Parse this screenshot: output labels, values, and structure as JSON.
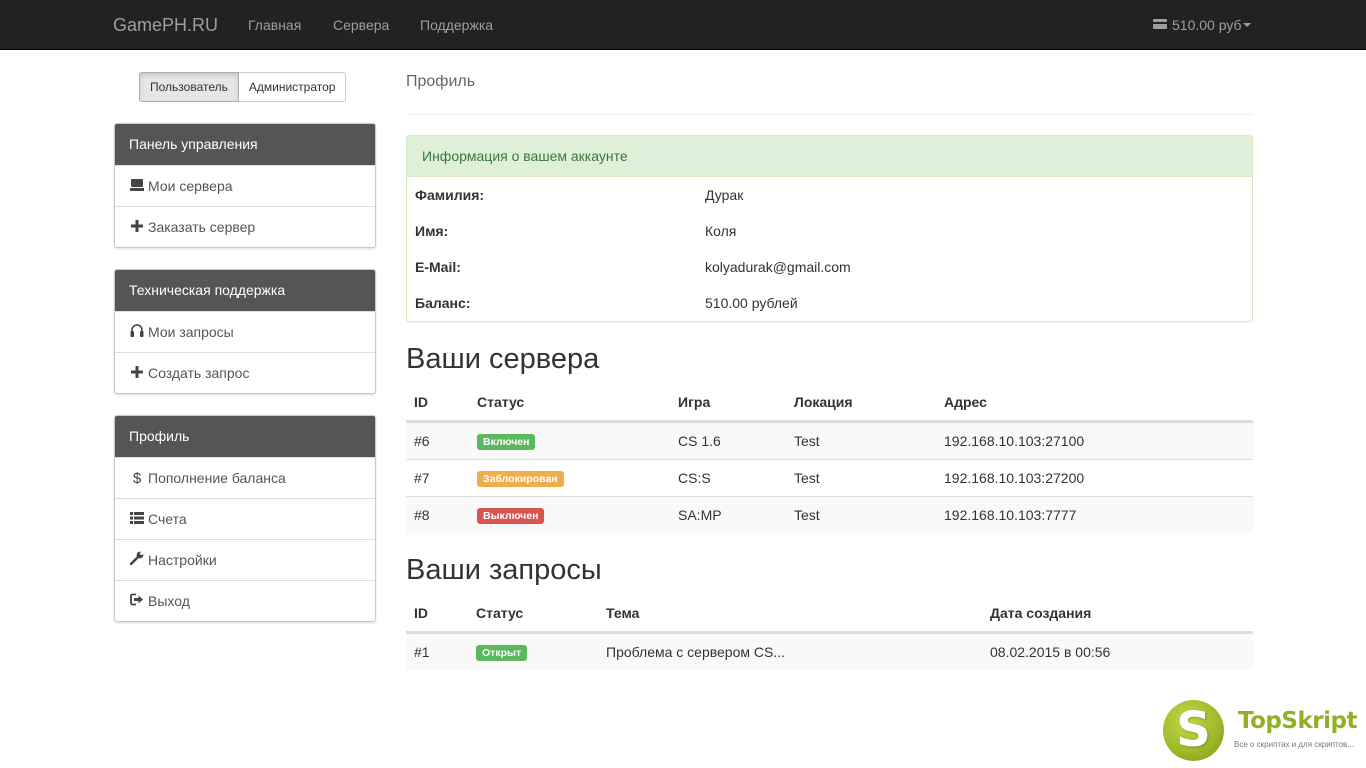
{
  "navbar": {
    "brand": "GamePH.RU",
    "links": [
      "Главная",
      "Сервера",
      "Поддержка"
    ],
    "balance": "510.00 руб"
  },
  "role_switch": {
    "user": "Пользователь",
    "admin": "Администратор"
  },
  "sidebar": {
    "panels": [
      {
        "heading": "Панель управления",
        "items": [
          {
            "label": "Мои сервера",
            "icon": "server-icon"
          },
          {
            "label": "Заказать сервер",
            "icon": "plus-icon"
          }
        ]
      },
      {
        "heading": "Техническая поддержка",
        "items": [
          {
            "label": "Мои запросы",
            "icon": "headphones-icon"
          },
          {
            "label": "Создать запрос",
            "icon": "plus-icon"
          }
        ]
      },
      {
        "heading": "Профиль",
        "items": [
          {
            "label": "Пополнение баланса",
            "icon": "dollar-icon"
          },
          {
            "label": "Счета",
            "icon": "list-icon"
          },
          {
            "label": "Настройки",
            "icon": "wrench-icon"
          },
          {
            "label": "Выход",
            "icon": "logout-icon"
          }
        ]
      }
    ]
  },
  "page": {
    "title": "Профиль"
  },
  "account": {
    "heading": "Информация о вашем аккаунте",
    "rows": [
      {
        "key": "Фамилия:",
        "value": "Дурак"
      },
      {
        "key": "Имя:",
        "value": "Коля"
      },
      {
        "key": "E-Mail:",
        "value": "kolyadurak@gmail.com"
      },
      {
        "key": "Баланс:",
        "value": "510.00 рублей"
      }
    ]
  },
  "servers": {
    "heading": "Ваши сервера",
    "columns": [
      "ID",
      "Статус",
      "Игра",
      "Локация",
      "Адрес"
    ],
    "rows": [
      {
        "id": "#6",
        "status": "Включен",
        "status_color": "#5cb85c",
        "game": "CS 1.6",
        "location": "Test",
        "address": "192.168.10.103:27100"
      },
      {
        "id": "#7",
        "status": "Заблокирован",
        "status_color": "#f0ad4e",
        "game": "CS:S",
        "location": "Test",
        "address": "192.168.10.103:27200"
      },
      {
        "id": "#8",
        "status": "Выключен",
        "status_color": "#d9534f",
        "game": "SA:MP",
        "location": "Test",
        "address": "192.168.10.103:7777"
      }
    ]
  },
  "requests": {
    "heading": "Ваши запросы",
    "columns": [
      "ID",
      "Статус",
      "Тема",
      "Дата создания"
    ],
    "rows": [
      {
        "id": "#1",
        "status": "Открыт",
        "status_color": "#5cb85c",
        "subject": "Проблема с сервером CS...",
        "date": "08.02.2015 в 00:56"
      }
    ]
  },
  "watermark": {
    "logo_letter": "S",
    "title": "TopSkript",
    "tagline": "Все о скриптах и для скриптов..."
  }
}
